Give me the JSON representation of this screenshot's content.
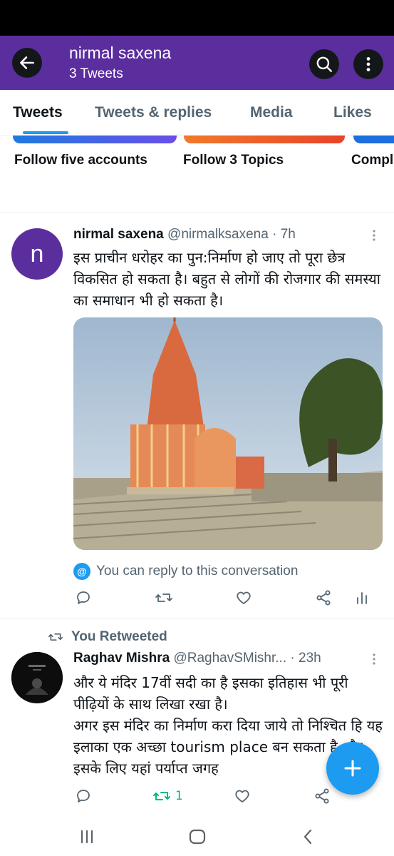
{
  "header": {
    "name": "nirmal saxena",
    "tweet_count": "3 Tweets",
    "bg_color": "#5b2e9e"
  },
  "tabs": [
    {
      "label": "Tweets",
      "active": true
    },
    {
      "label": "Tweets & replies",
      "active": false
    },
    {
      "label": "Media",
      "active": false
    },
    {
      "label": "Likes",
      "active": false
    }
  ],
  "carousel": {
    "cards": [
      {
        "title": "Follow five accounts"
      },
      {
        "title": "Follow 3 Topics"
      },
      {
        "title": "Compl"
      }
    ]
  },
  "tweets": [
    {
      "avatar_letter": "n",
      "name": "nirmal saxena",
      "handle": "@nirmalksaxena",
      "sep": "·",
      "time": "7h",
      "text": "इस प्राचीन धरोहर का पुन:निर्माण हो जाए तो पूरा छेत्र विकसित हो सकता है। बहुत से लोगों की रोजगार की समस्या का समाधान भी हो सकता है।",
      "reply_note": "You can reply to this conversation",
      "retweets": ""
    },
    {
      "retweet_label": "You Retweeted",
      "name": "Raghav Mishra",
      "handle": "@RaghavSMishr...",
      "sep": "·",
      "time": "23h",
      "text_line1": "और ये मंदिर 17वीं सदी का है इसका इतिहास भी  पूरी पीढ़ियों के साथ लिखा रखा है।",
      "text_line2": "अगर इस मंदिर का निर्माण करा दिया जाये तो निश्चित हि यह इलाका एक अच्छा tourism place बन सकता है और इसके लिए यहां पर्याप्त जगह",
      "retweets": "1"
    }
  ],
  "icons": {
    "back": "arrow-left-icon",
    "search": "search-icon",
    "more": "more-vertical-icon",
    "reply": "reply-icon",
    "retweet": "retweet-icon",
    "like": "heart-icon",
    "share": "share-icon",
    "analytics": "analytics-icon",
    "compose": "plus-icon"
  },
  "colors": {
    "accent": "#1d9bf0",
    "retweet_active": "#00ba7c",
    "muted": "#536471"
  }
}
